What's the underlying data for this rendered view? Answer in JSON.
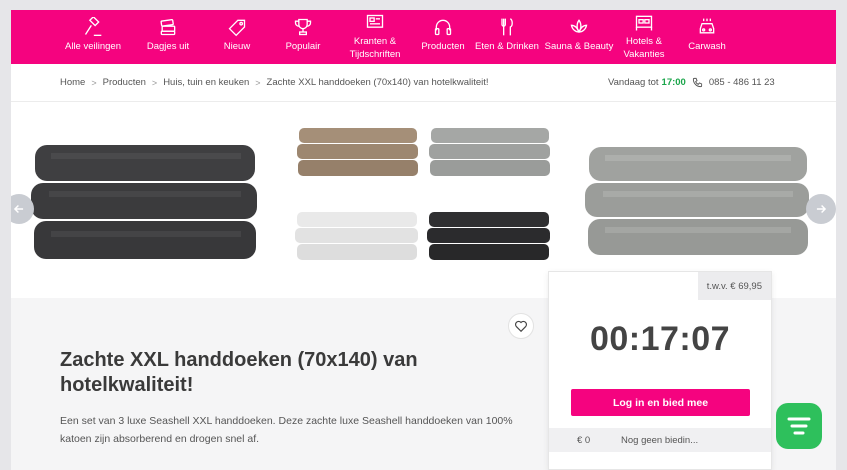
{
  "nav": {
    "items": [
      {
        "label": "Alle veilingen",
        "icon": "gavel-icon"
      },
      {
        "label": "Dagjes uit",
        "icon": "tickets-icon"
      },
      {
        "label": "Nieuw",
        "icon": "tag-icon"
      },
      {
        "label": "Populair",
        "icon": "trophy-icon"
      },
      {
        "label": "Kranten & Tijdschriften",
        "icon": "newspaper-icon"
      },
      {
        "label": "Producten",
        "icon": "headphones-icon"
      },
      {
        "label": "Eten & Drinken",
        "icon": "cutlery-icon"
      },
      {
        "label": "Sauna & Beauty",
        "icon": "lotus-icon"
      },
      {
        "label": "Hotels & Vakanties",
        "icon": "bed-icon"
      },
      {
        "label": "Carwash",
        "icon": "car-wash-icon"
      }
    ]
  },
  "breadcrumb": {
    "items": [
      "Home",
      "Producten",
      "Huis, tuin en keuken",
      "Zachte XXL handdoeken (70x140) van hotelkwaliteit!"
    ],
    "separator": ">"
  },
  "contact": {
    "open_label": "Vandaag tot",
    "open_time": "17:00",
    "phone": "085 - 486 11 23"
  },
  "gallery": {
    "images": [
      "dark-grey-towels",
      "four-color-towel-sets",
      "light-grey-towels"
    ]
  },
  "product": {
    "title": "Zachte XXL handdoeken (70x140) van hotelkwaliteit!",
    "description": "Een set van 3 luxe Seashell XXL handdoeken. Deze zachte luxe Seashell handdoeken van 100% katoen zijn absorberend en drogen snel af."
  },
  "bid": {
    "rrp": "t.w.v. € 69,95",
    "countdown": "00:17:07",
    "button_label": "Log in en bied mee",
    "current_amount": "€ 0",
    "status": "Nog geen biedin..."
  },
  "colors": {
    "brand": "#f5037f",
    "open_time": "#1aa54a",
    "chat": "#2ec05c"
  }
}
